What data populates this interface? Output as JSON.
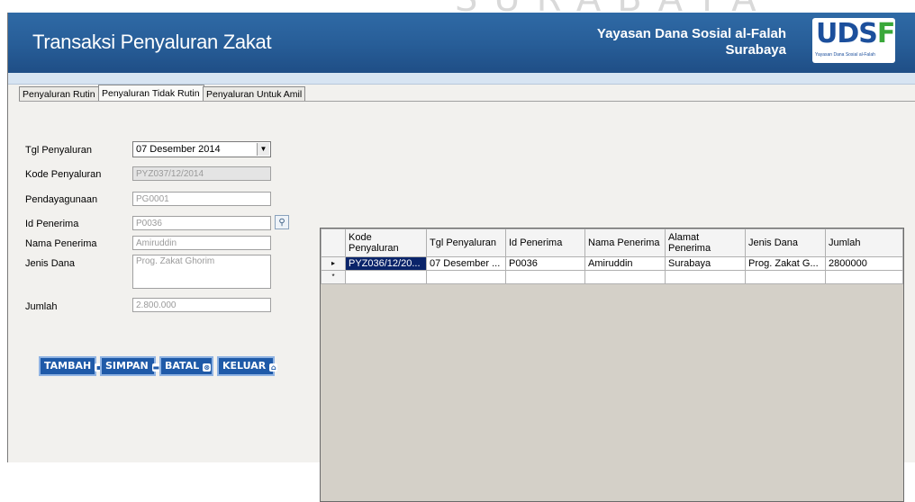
{
  "watermark": "SURABAYA",
  "header": {
    "title": "Transaksi Penyaluran Zakat",
    "org_line1": "Yayasan Dana Sosial al-Falah",
    "org_line2": "Surabaya",
    "logo_text_a": "UDS",
    "logo_text_b": "F",
    "logo_tagline": "Yayasan Dana Sosial al-Falah"
  },
  "tabs": [
    {
      "label": "Penyaluran Rutin",
      "active": false
    },
    {
      "label": "Penyaluran Tidak Rutin",
      "active": true
    },
    {
      "label": "Penyaluran Untuk Amil",
      "active": false
    }
  ],
  "form": {
    "tgl_label": "Tgl Penyaluran",
    "tgl_value": "07 Desember 2014",
    "kode_label": "Kode Penyaluran",
    "kode_value": "PYZ037/12/2014",
    "pendayagunaan_label": "Pendayagunaan",
    "pendayagunaan_value": "PG0001",
    "id_penerima_label": "Id Penerima",
    "id_penerima_value": "P0036",
    "nama_label": "Nama Penerima",
    "nama_value": "Amiruddin",
    "jenis_label": "Jenis Dana",
    "jenis_value": "Prog. Zakat Ghorim",
    "jumlah_label": "Jumlah",
    "jumlah_value": "2.800.000"
  },
  "buttons": {
    "tambah": "TAMBAH",
    "simpan": "SIMPAN",
    "batal": "BATAL",
    "keluar": "KELUAR"
  },
  "grid": {
    "columns": [
      "Kode Penyaluran",
      "Tgl Penyaluran",
      "Id Penerima",
      "Nama Penerima",
      "Alamat Penerima",
      "Jenis Dana",
      "Jumlah"
    ],
    "rows": [
      [
        "PYZ036/12/20...",
        "07 Desember ...",
        "P0036",
        "Amiruddin",
        "Surabaya",
        "Prog. Zakat G...",
        "2800000"
      ]
    ],
    "current_row_marker": "▸",
    "new_row_marker": "*"
  }
}
